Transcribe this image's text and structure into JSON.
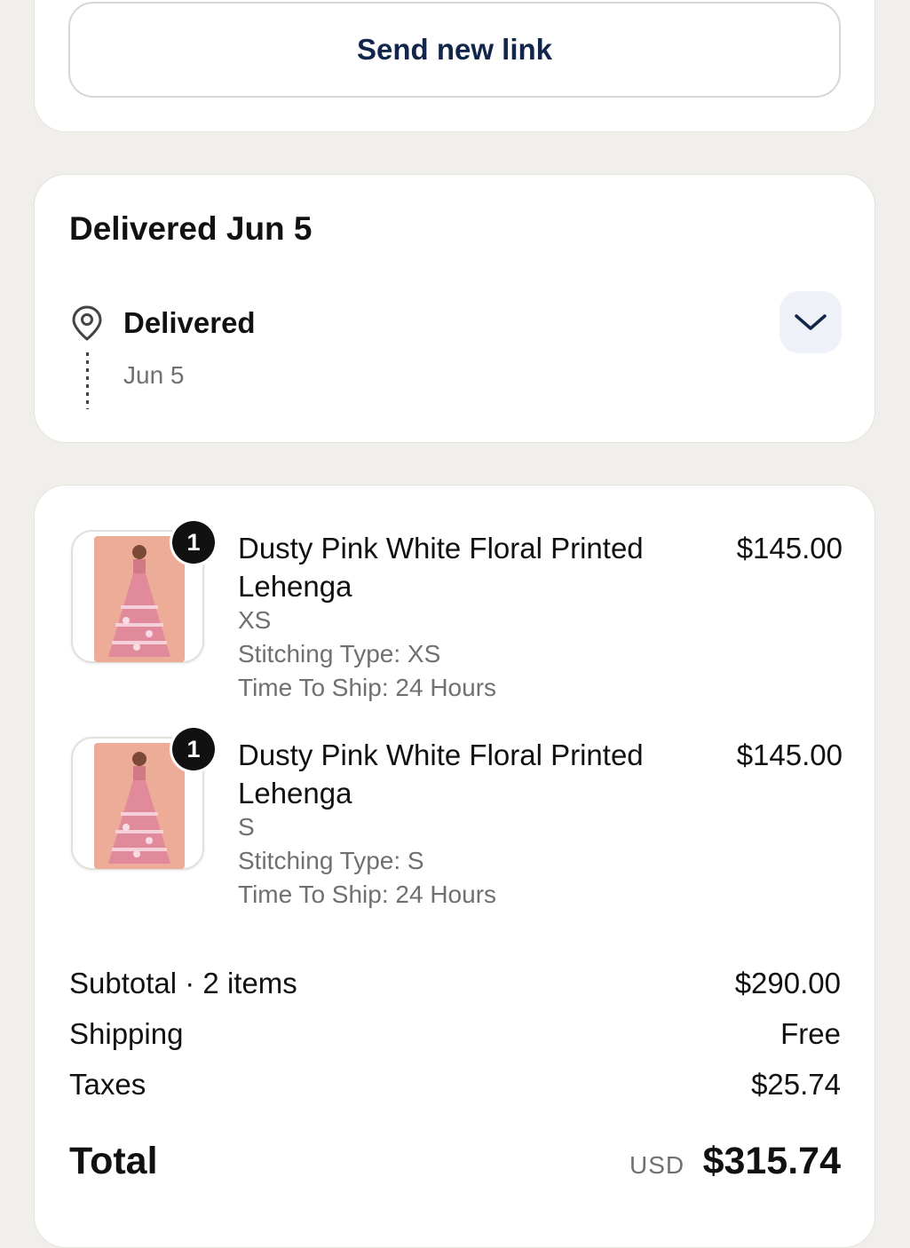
{
  "link_card": {
    "button_label": "Send new link"
  },
  "delivery": {
    "title": "Delivered Jun 5",
    "status": "Delivered",
    "status_date": "Jun 5",
    "icons": {
      "location": "location-pin-icon",
      "toggle": "chevron-down-icon"
    }
  },
  "order": {
    "items": [
      {
        "quantity": "1",
        "name": "Dusty Pink White Floral Printed Lehenga",
        "price": "$145.00",
        "size": "XS",
        "stitching": "Stitching Type: XS",
        "ship_time": "Time To Ship: 24 Hours"
      },
      {
        "quantity": "1",
        "name": "Dusty Pink White Floral Printed Lehenga",
        "price": "$145.00",
        "size": "S",
        "stitching": "Stitching Type: S",
        "ship_time": "Time To Ship: 24 Hours"
      }
    ],
    "summary": {
      "subtotal_label": "Subtotal · 2 items",
      "subtotal_value": "$290.00",
      "shipping_label": "Shipping",
      "shipping_value": "Free",
      "taxes_label": "Taxes",
      "taxes_value": "$25.74",
      "total_label": "Total",
      "currency": "USD",
      "total_value": "$315.74"
    }
  },
  "colors": {
    "accent": "#11264a",
    "background": "#f1efeb",
    "muted_text": "#707070"
  }
}
